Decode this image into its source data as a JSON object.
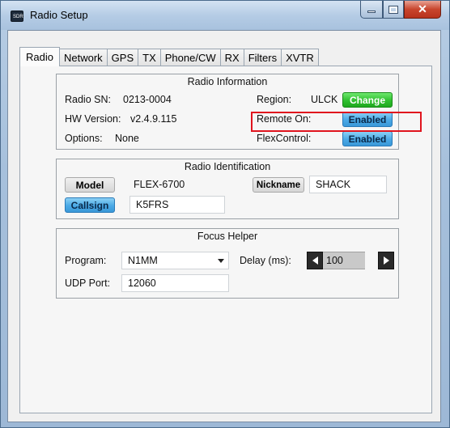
{
  "window": {
    "title": "Radio Setup",
    "icon_label": "SDR"
  },
  "tabs": [
    {
      "label": "Radio",
      "active": true
    },
    {
      "label": "Network"
    },
    {
      "label": "GPS"
    },
    {
      "label": "TX"
    },
    {
      "label": "Phone/CW"
    },
    {
      "label": "RX"
    },
    {
      "label": "Filters"
    },
    {
      "label": "XVTR"
    }
  ],
  "radio_info": {
    "title": "Radio Information",
    "sn_label": "Radio SN:",
    "sn_value": "0213-0004",
    "hw_label": "HW Version:",
    "hw_value": "v2.4.9.115",
    "options_label": "Options:",
    "options_value": "None",
    "region_label": "Region:",
    "region_value": "ULCK",
    "change_button": "Change",
    "remote_label": "Remote On:",
    "remote_button": "Enabled",
    "flexcontrol_label": "FlexControl:",
    "flexcontrol_button": "Enabled"
  },
  "radio_id": {
    "title": "Radio Identification",
    "model_button": "Model",
    "model_value": "FLEX-6700",
    "nickname_button": "Nickname",
    "nickname_value": "SHACK",
    "callsign_button": "Callsign",
    "callsign_value": "K5FRS"
  },
  "focus_helper": {
    "title": "Focus Helper",
    "program_label": "Program:",
    "program_value": "N1MM",
    "delay_label": "Delay (ms):",
    "delay_value": "100",
    "udp_label": "UDP Port:",
    "udp_value": "12060"
  },
  "colors": {
    "highlight": "#e0141e",
    "green_button": "#2fbf2f",
    "blue_button": "#4aa9e6"
  }
}
